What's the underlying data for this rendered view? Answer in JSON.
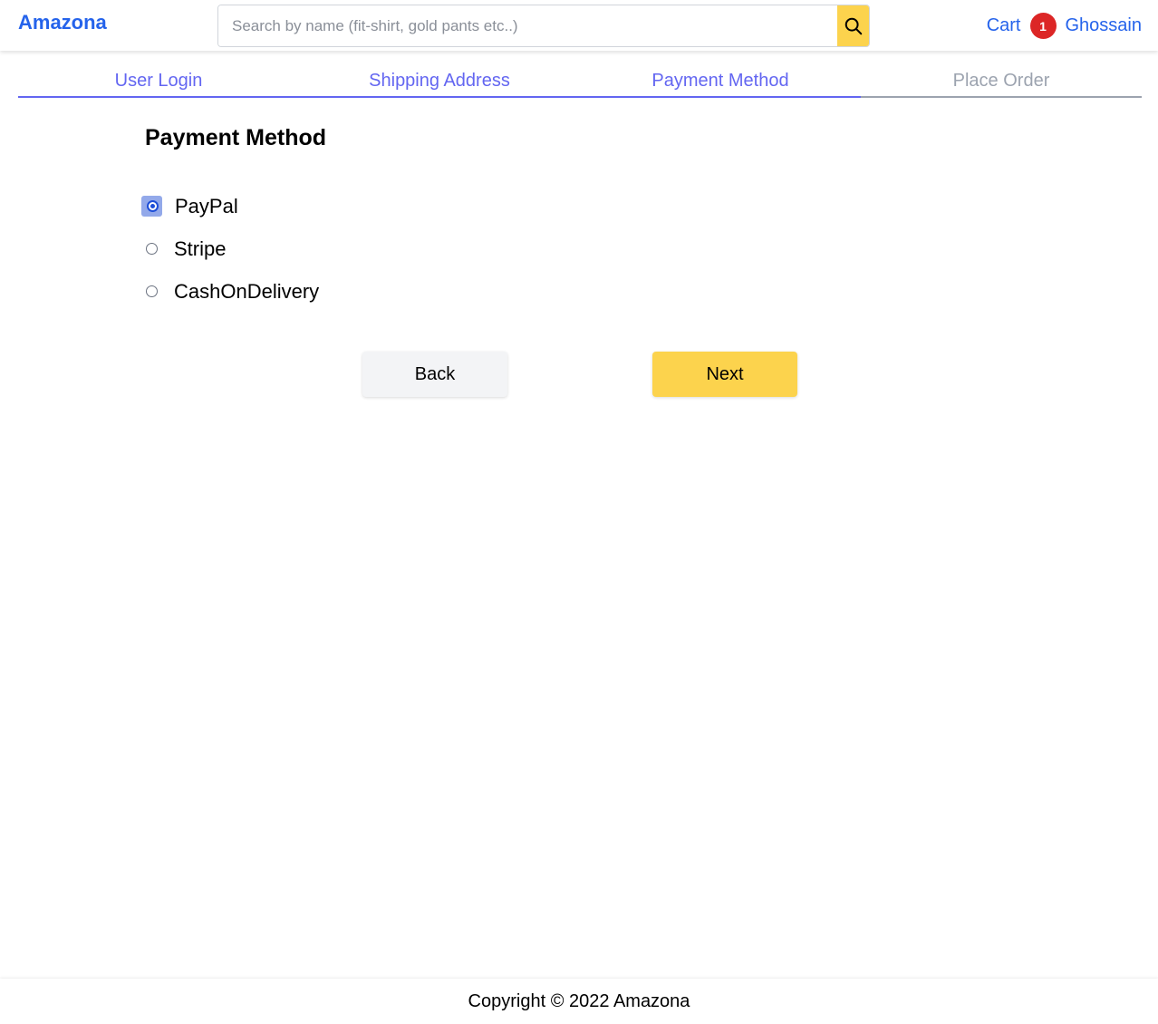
{
  "header": {
    "brand": "Amazona",
    "search_placeholder": "Search by name (fit-shirt, gold pants etc..)",
    "search_value": "",
    "cart_label": "Cart",
    "cart_count": "1",
    "user_name": "Ghossain",
    "icons": {
      "search": "search-icon"
    }
  },
  "steps": [
    {
      "label": "User Login",
      "active": true
    },
    {
      "label": "Shipping Address",
      "active": true
    },
    {
      "label": "Payment Method",
      "active": true
    },
    {
      "label": "Place Order",
      "active": false
    }
  ],
  "form": {
    "title": "Payment Method",
    "options": [
      {
        "label": "PayPal",
        "checked": true
      },
      {
        "label": "Stripe",
        "checked": false
      },
      {
        "label": "CashOnDelivery",
        "checked": false
      }
    ],
    "back_label": "Back",
    "next_label": "Next"
  },
  "footer": {
    "text": "Copyright © 2022 Amazona"
  },
  "colors": {
    "brand": "#2563eb",
    "accent": "#fcd34d",
    "badge": "#dc2626",
    "step_active": "#6366f1",
    "step_inactive": "#9ca3af"
  }
}
